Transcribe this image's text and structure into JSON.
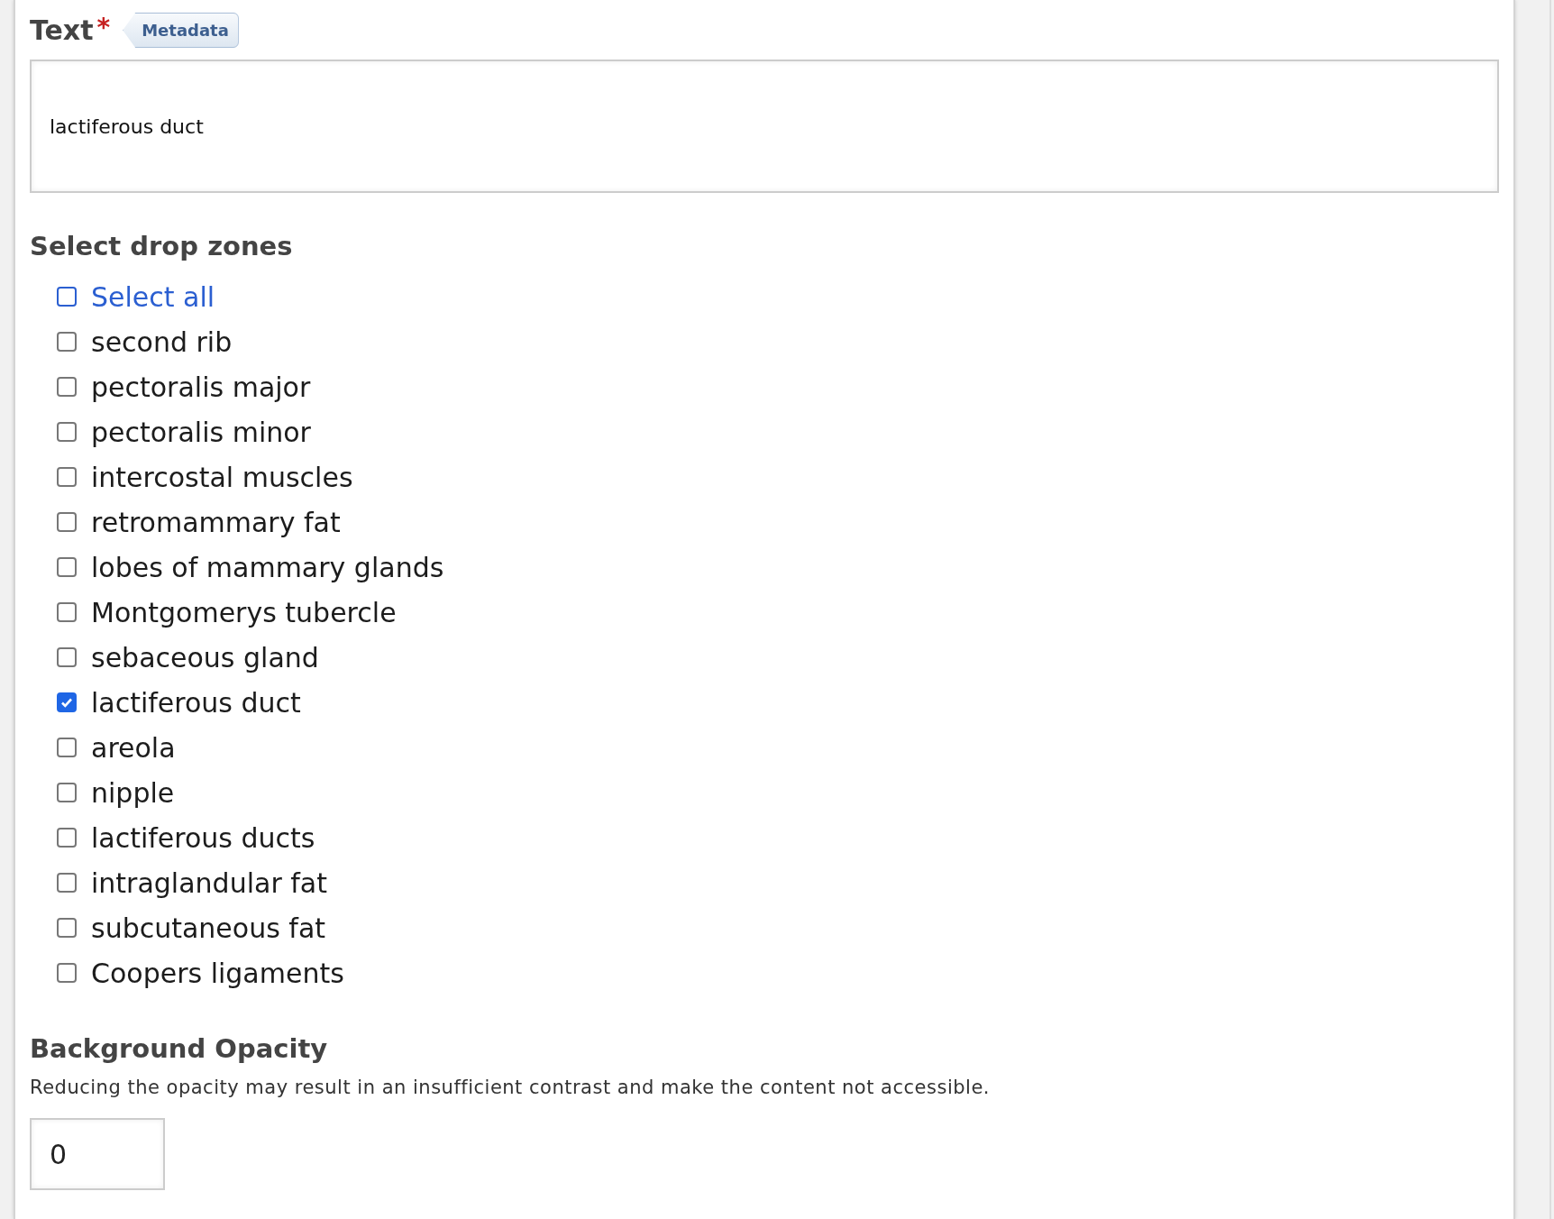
{
  "text_field": {
    "label": "Text",
    "required_mark": "*",
    "metadata_tag": "Metadata",
    "value": "lactiferous duct"
  },
  "drop_zones": {
    "heading": "Select drop zones",
    "select_all": {
      "label": "Select all",
      "checked": false
    },
    "items": [
      {
        "label": "second rib",
        "checked": false
      },
      {
        "label": "pectoralis major",
        "checked": false
      },
      {
        "label": "pectoralis minor",
        "checked": false
      },
      {
        "label": "intercostal muscles",
        "checked": false
      },
      {
        "label": "retromammary fat",
        "checked": false
      },
      {
        "label": "lobes of mammary glands",
        "checked": false
      },
      {
        "label": "Montgomerys tubercle",
        "checked": false
      },
      {
        "label": "sebaceous gland",
        "checked": false
      },
      {
        "label": "lactiferous duct",
        "checked": true
      },
      {
        "label": "areola",
        "checked": false
      },
      {
        "label": "nipple",
        "checked": false
      },
      {
        "label": "lactiferous ducts",
        "checked": false
      },
      {
        "label": "intraglandular fat",
        "checked": false
      },
      {
        "label": "subcutaneous fat",
        "checked": false
      },
      {
        "label": "Coopers ligaments",
        "checked": false
      }
    ]
  },
  "background_opacity": {
    "heading": "Background Opacity",
    "description": "Reducing the opacity may result in an insufficient contrast and make the content not accessible.",
    "value": "0"
  }
}
